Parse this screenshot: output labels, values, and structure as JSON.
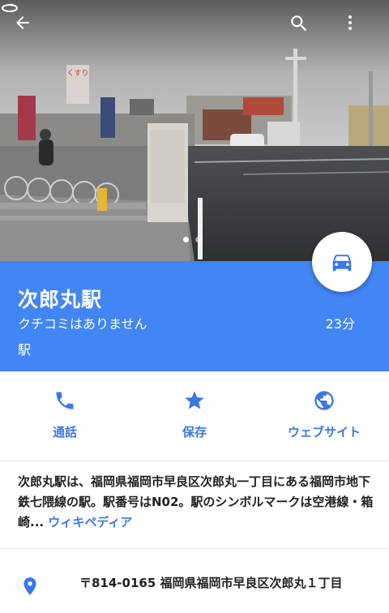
{
  "header": {
    "back_icon": "arrow-back-icon",
    "search_icon": "search-icon",
    "more_icon": "more-vert-icon"
  },
  "photo": {
    "shop_sign": "くすり",
    "page_count": 2,
    "active_page": 1
  },
  "place": {
    "title": "次郎丸駅",
    "reviews": "クチコミはありません",
    "category": "駅",
    "travel_time": "23分",
    "travel_mode_icon": "car-icon"
  },
  "actions": [
    {
      "label": "通話",
      "icon": "phone-icon"
    },
    {
      "label": "保存",
      "icon": "star-icon"
    },
    {
      "label": "ウェブサイト",
      "icon": "globe-icon"
    }
  ],
  "description": {
    "text": "次郎丸駅は、福岡県福岡市早良区次郎丸一丁目にある福岡市地下鉄七隈線の駅。駅番号はN02。駅のシンボルマークは空港線・箱崎...",
    "link": "ウィキペディア"
  },
  "address": {
    "icon": "place-pin-icon",
    "text": "〒814-0165 福岡県福岡市早良区次郎丸１丁目"
  },
  "colors": {
    "primary": "#4285f4",
    "accent_text": "#3b78e7"
  }
}
